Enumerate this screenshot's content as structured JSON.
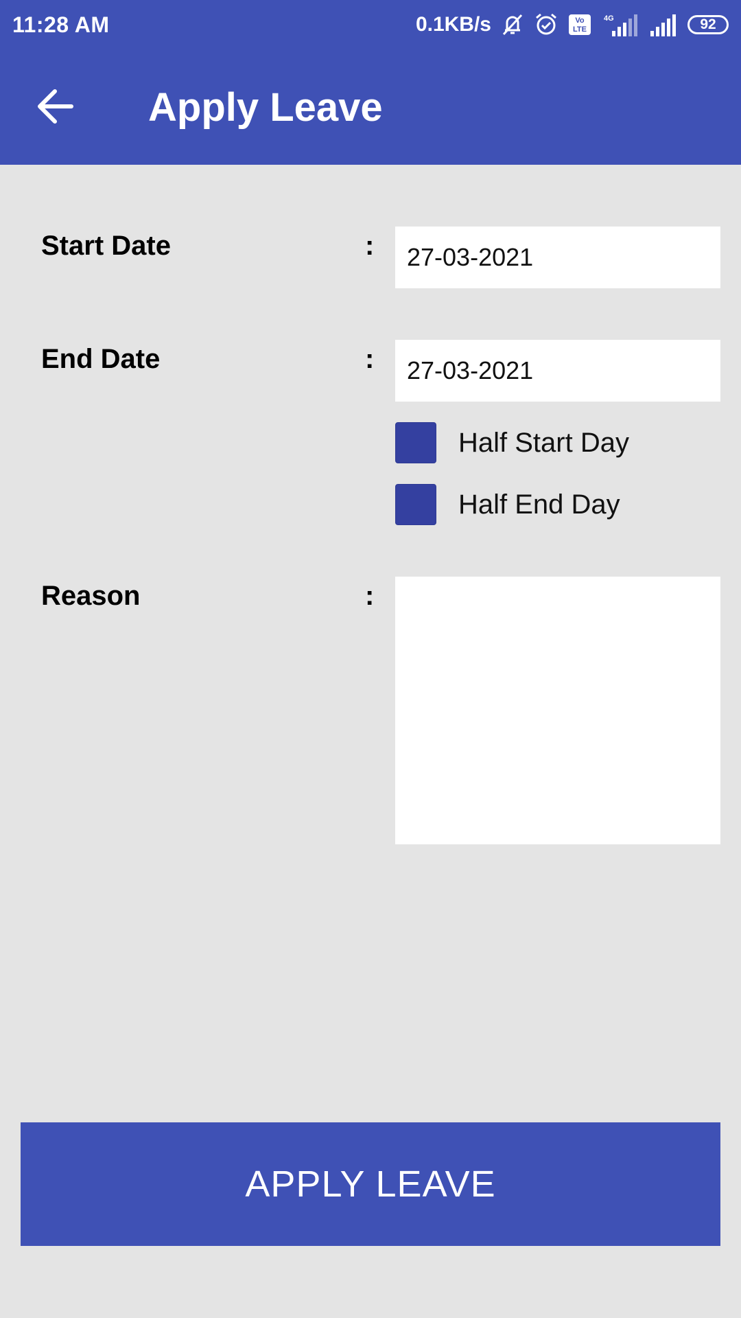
{
  "status_bar": {
    "time": "11:28 AM",
    "net_speed": "0.1KB/s",
    "volte_label": "Vo LTE",
    "network_type": "4G",
    "battery": "92",
    "icons": [
      "bell-off-icon",
      "alarm-icon",
      "volte-icon",
      "signal-4g-icon",
      "signal-icon",
      "battery-icon"
    ]
  },
  "toolbar": {
    "title": "Apply Leave",
    "back_icon": "arrow-left-icon"
  },
  "form": {
    "start_date": {
      "label": "Start Date",
      "separator": ":",
      "value": "27-03-2021"
    },
    "end_date": {
      "label": "End Date",
      "separator": ":",
      "value": "27-03-2021"
    },
    "half_start_day": {
      "label": "Half Start Day"
    },
    "half_end_day": {
      "label": "Half End Day"
    },
    "reason": {
      "label": "Reason",
      "separator": ":",
      "value": ""
    }
  },
  "submit": {
    "label": "APPLY LEAVE"
  },
  "colors": {
    "primary": "#3f51b5",
    "checkbox": "#3440a0",
    "background": "#e4e4e4",
    "field": "#ffffff"
  }
}
